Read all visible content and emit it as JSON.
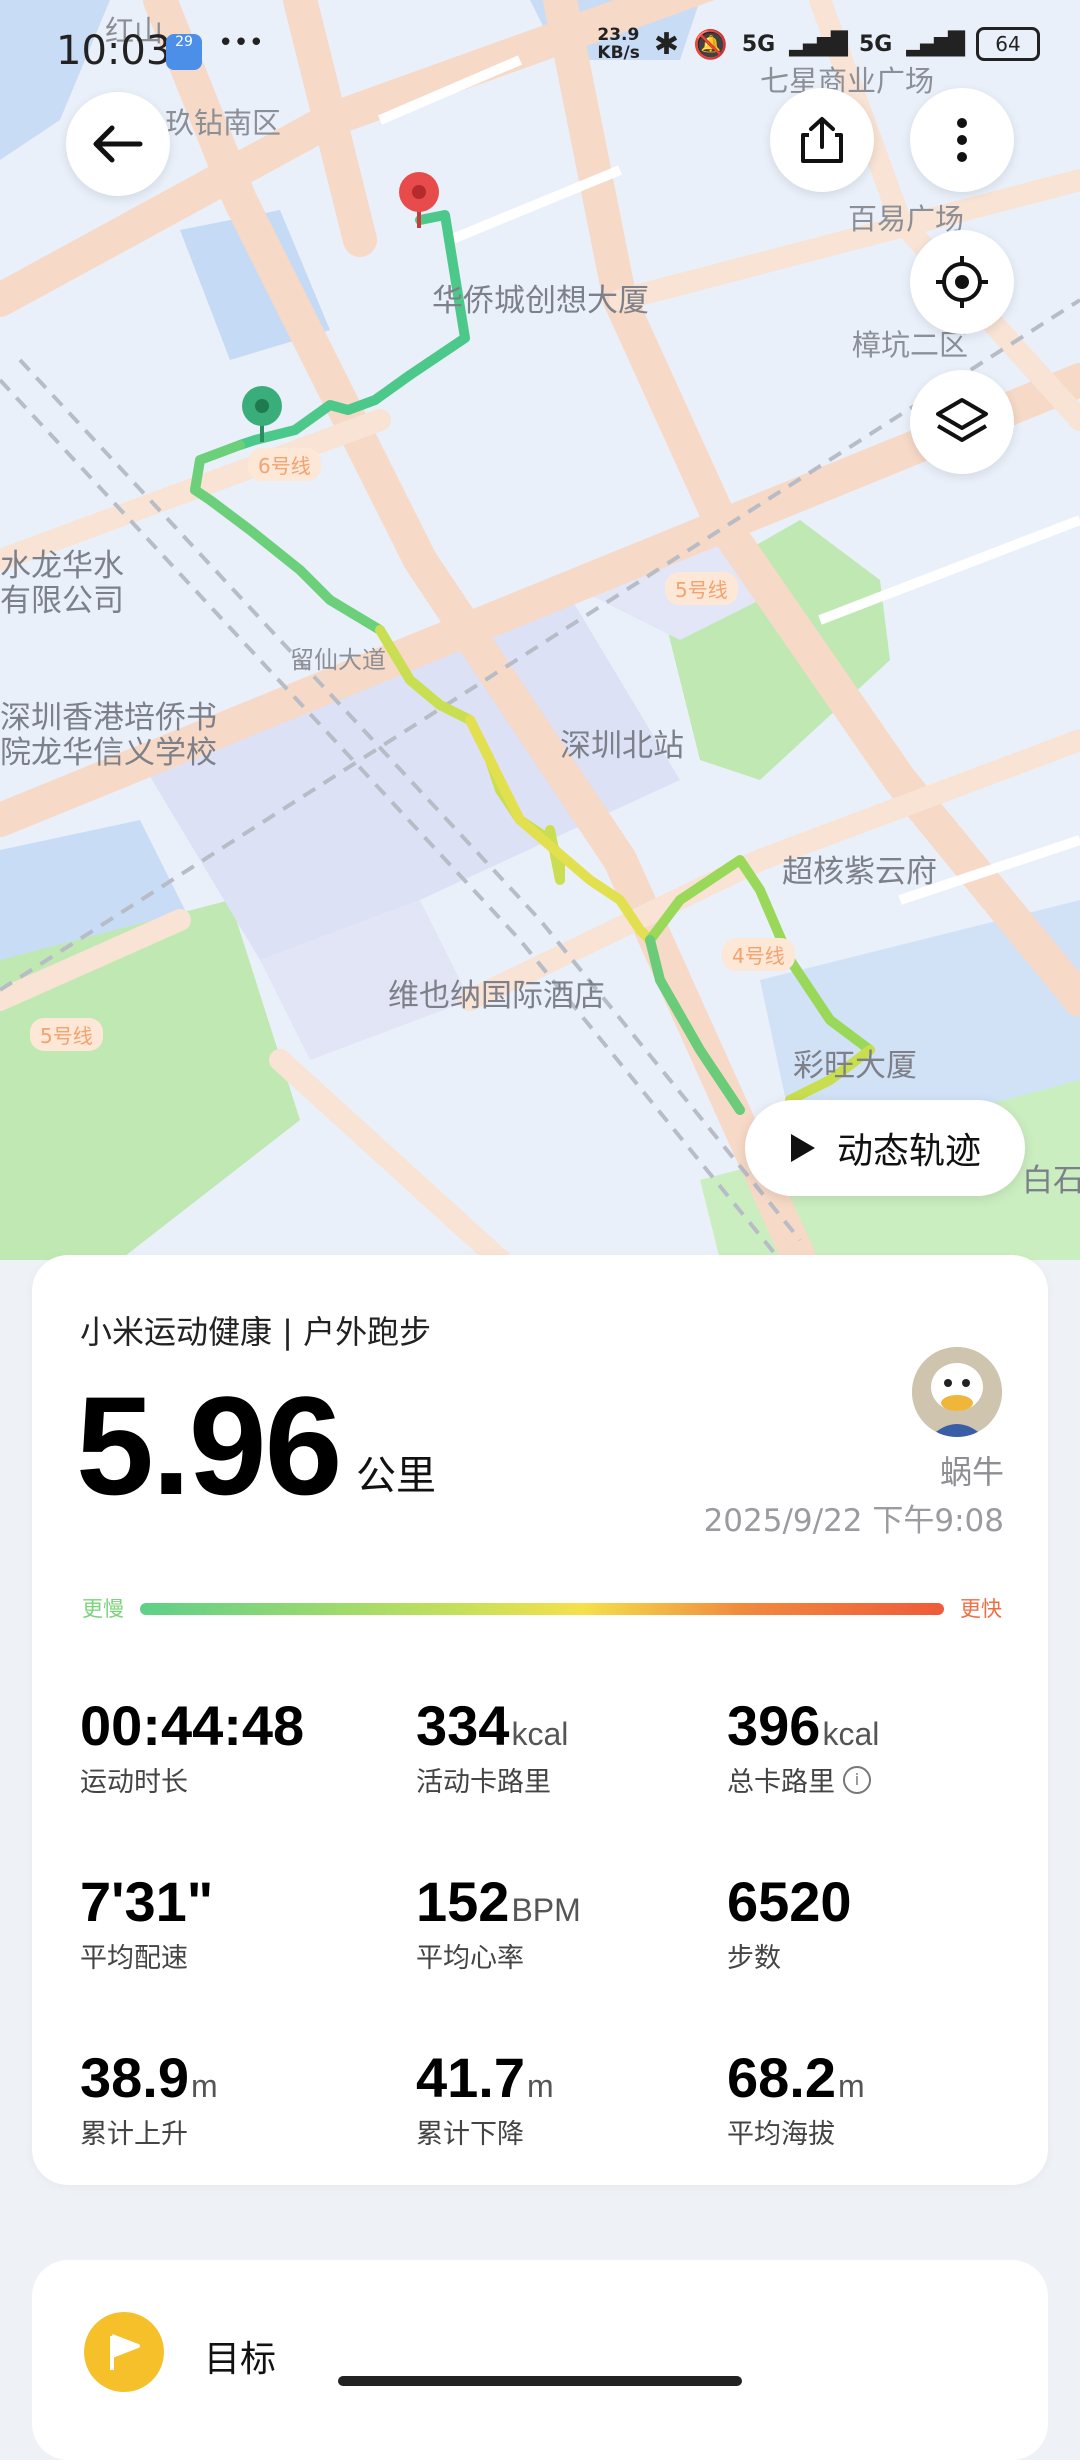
{
  "status_bar": {
    "time": "10:03",
    "date_badge": "29",
    "more": "•••",
    "net_speed_value": "23.9",
    "net_speed_unit": "KB/s",
    "sim1": "5G",
    "sim2": "5G",
    "battery": "64"
  },
  "map": {
    "labels": {
      "hongshan": "红山",
      "jiujiu": "玖钻南区",
      "qixing": "七星商业广场",
      "baiyi": "百易广场",
      "zhangkeng": "樟坑二区",
      "huaqiao": "华侨城创想大厦",
      "shuilong1": "水龙华水",
      "shuilong2": "有限公司",
      "liuxian": "留仙大道",
      "school1": "深圳香港培侨书",
      "school2": "院龙华信义学校",
      "north_station": "深圳北站",
      "chaohe": "超核紫云府",
      "vienna": "维也纳国际酒店",
      "caiwang": "彩旺大厦",
      "baishi": "白石"
    },
    "metro_badges": {
      "line6": "6号线",
      "line5a": "5号线",
      "line4": "4号线",
      "line5b": "5号线"
    },
    "colors": {
      "route_slow": "#4cc98a",
      "route_mid": "#e6e64a",
      "start_pin": "#3aae7a",
      "end_pin": "#e84b4b"
    }
  },
  "controls": {
    "back": "back-arrow",
    "share": "share-icon",
    "more": "more-vertical-icon",
    "locate": "locate-icon",
    "layers": "layers-icon",
    "replay_label": "动态轨迹"
  },
  "summary": {
    "source": "小米运动健康 | 户外跑步",
    "distance": "5.96",
    "distance_unit": "公里",
    "user_name": "蜗牛",
    "datetime": "2025/9/22 下午9:08",
    "scale_slow": "更慢",
    "scale_fast": "更快"
  },
  "stats": {
    "duration": {
      "value": "00:44:48",
      "unit": "",
      "label": "运动时长"
    },
    "active_cal": {
      "value": "334",
      "unit": "kcal",
      "label": "活动卡路里"
    },
    "total_cal": {
      "value": "396",
      "unit": "kcal",
      "label": "总卡路里",
      "info": "i"
    },
    "pace": {
      "value": "7'31\"",
      "unit": "",
      "label": "平均配速"
    },
    "heart": {
      "value": "152",
      "unit": "BPM",
      "label": "平均心率"
    },
    "steps": {
      "value": "6520",
      "unit": "",
      "label": "步数"
    },
    "ascent": {
      "value": "38.9",
      "unit": "m",
      "label": "累计上升"
    },
    "descent": {
      "value": "41.7",
      "unit": "m",
      "label": "累计下降"
    },
    "altitude": {
      "value": "68.2",
      "unit": "m",
      "label": "平均海拔"
    }
  },
  "goal": {
    "label": "目标"
  }
}
